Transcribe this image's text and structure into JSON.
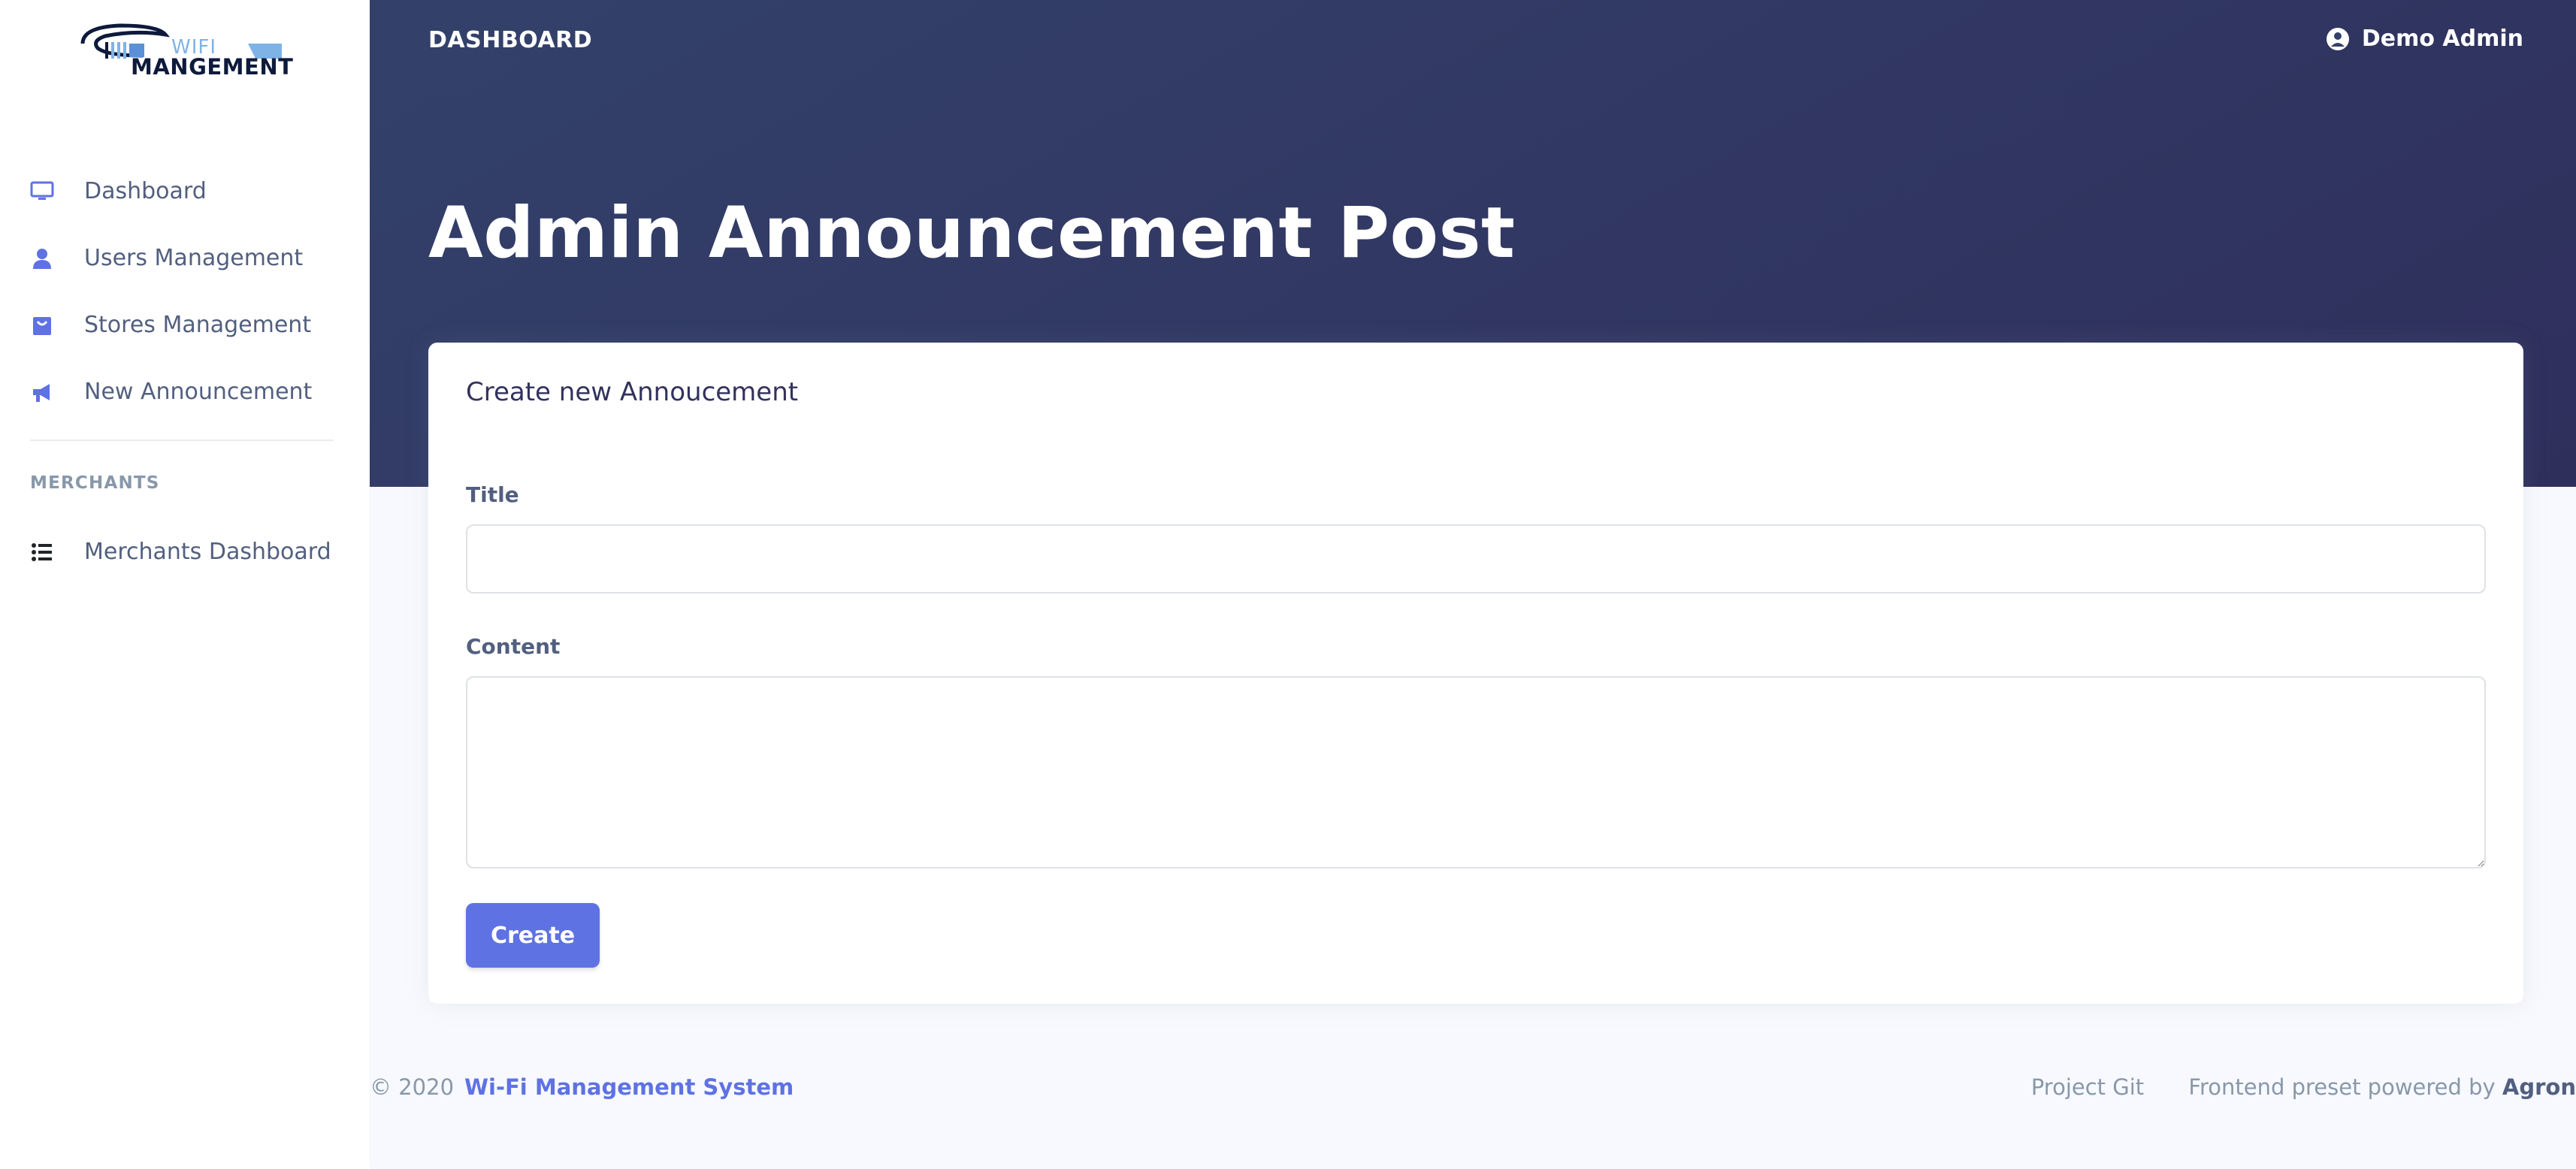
{
  "logo": {
    "line1": "WIFI",
    "line2": "MANGEMENT"
  },
  "sidebar": {
    "items": [
      {
        "label": "Dashboard",
        "icon": "monitor-icon"
      },
      {
        "label": "Users Management",
        "icon": "user-icon"
      },
      {
        "label": "Stores Management",
        "icon": "shopping-bag-icon"
      },
      {
        "label": "New Announcement",
        "icon": "megaphone-icon"
      }
    ],
    "section_heading": "MERCHANTS",
    "section_items": [
      {
        "label": "Merchants Dashboard",
        "icon": "list-icon"
      }
    ]
  },
  "header": {
    "breadcrumb": "DASHBOARD",
    "user_name": "Demo Admin",
    "page_title": "Admin Announcement Post"
  },
  "form": {
    "card_title": "Create new Annoucement",
    "title_label": "Title",
    "title_value": "",
    "content_label": "Content",
    "content_value": "",
    "submit_label": "Create"
  },
  "footer": {
    "copyright": "© 2020",
    "brand": "Wi-Fi Management System",
    "links": [
      "Project Git",
      "Frontend preset powered by"
    ],
    "powered_by": "Agron"
  },
  "colors": {
    "accent": "#5e72e4",
    "header_start": "#33416a",
    "header_end": "#2f2f5c"
  }
}
